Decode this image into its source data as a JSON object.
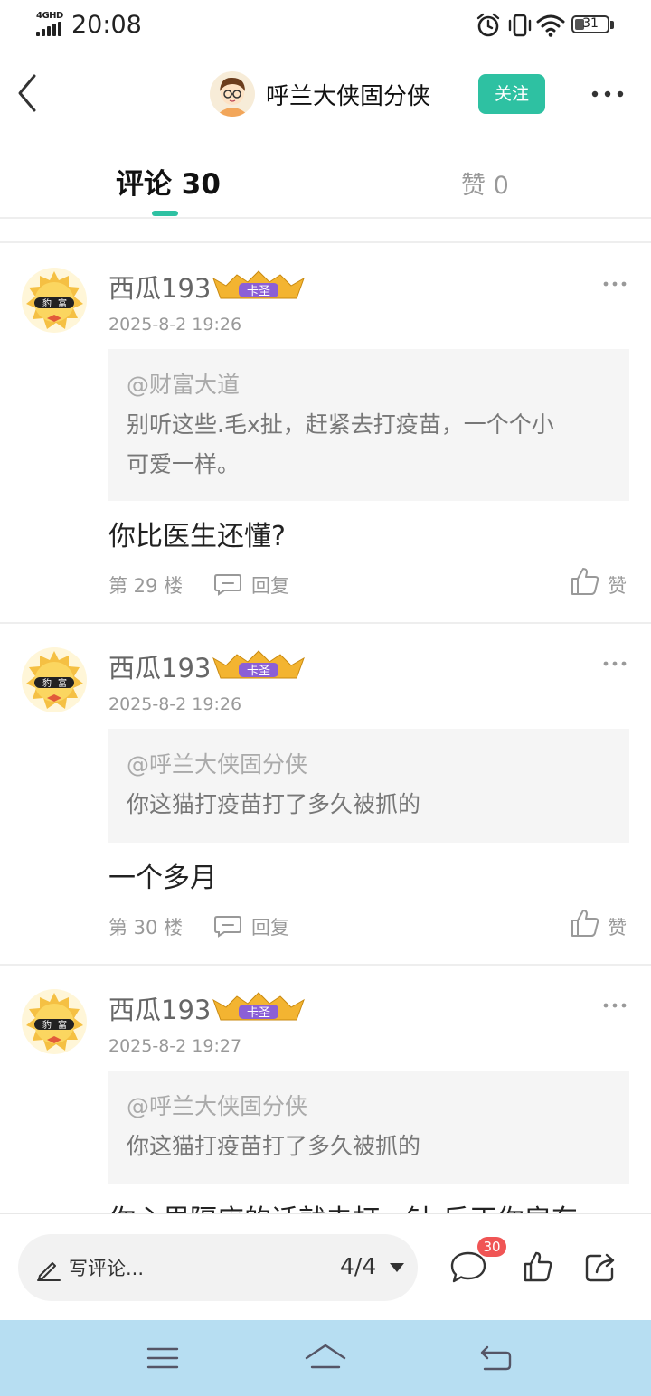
{
  "status_bar": {
    "network": "4GHD",
    "time": "20:08",
    "battery": "31"
  },
  "header": {
    "author_name": "呼兰大侠固分侠",
    "follow_label": "关注"
  },
  "tabs": {
    "comments": "评论 30",
    "likes": "赞 0"
  },
  "comments": [
    {
      "user": "西瓜193",
      "badge": "卡圣",
      "time": "2025-8-2 19:26",
      "quote_mention": "@财富大道",
      "quote_lines": [
        "别听这些.毛x扯，赶紧去打疫苗，一个个小",
        "可爱一样。"
      ],
      "body": "你比医生还懂?",
      "floor": "第 29 楼",
      "reply_label": "回复",
      "like_label": "赞"
    },
    {
      "user": "西瓜193",
      "badge": "卡圣",
      "time": "2025-8-2 19:26",
      "quote_mention": "@呼兰大侠固分侠",
      "quote_lines": [
        "你这猫打疫苗打了多久被抓的"
      ],
      "body": "一个多月",
      "floor": "第 30 楼",
      "reply_label": "回复",
      "like_label": "赞"
    },
    {
      "user": "西瓜193",
      "badge": "卡圣",
      "time": "2025-8-2 19:27",
      "quote_mention": "@呼兰大侠固分侠",
      "quote_lines": [
        "你这猫打疫苗打了多久被抓的"
      ],
      "body": "你心里隔应的话就去打一针 反正你房东"
    }
  ],
  "bottom_bar": {
    "compose_placeholder": "写评论...",
    "page_indicator": "4/4",
    "comment_count": "30"
  },
  "colors": {
    "accent": "#2ec1a2",
    "badge_red": "#f05555",
    "nav_bar": "#b7def2"
  }
}
